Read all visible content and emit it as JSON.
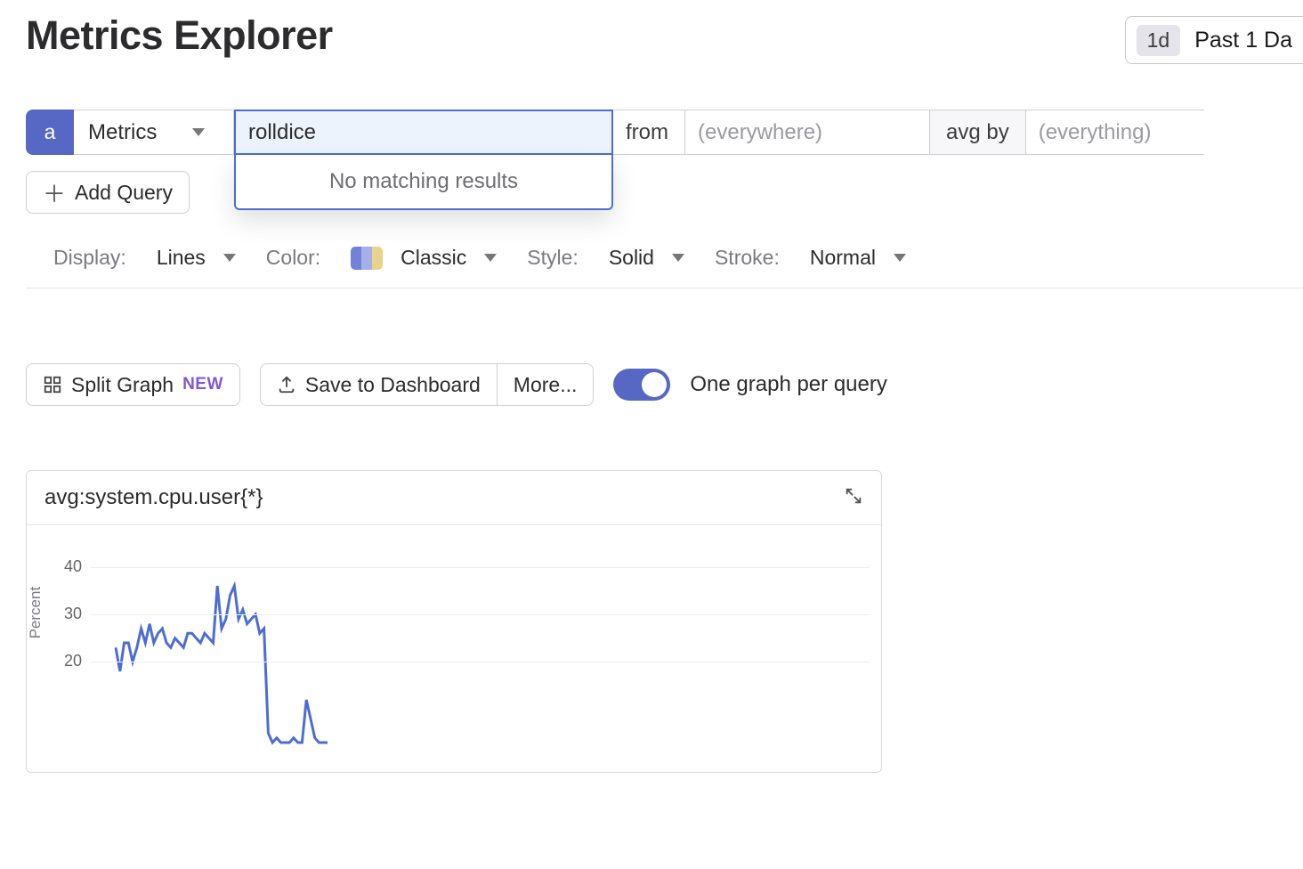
{
  "header": {
    "title": "Metrics Explorer",
    "time_pill": "1d",
    "time_label": "Past 1 Da"
  },
  "query": {
    "tag": "a",
    "source_label": "Metrics",
    "input_value": "rolldice",
    "dropdown_msg": "No matching results",
    "from_label": "from",
    "from_placeholder": "(everywhere)",
    "avg_by_label": "avg by",
    "group_placeholder": "(everything)",
    "add_query": "Add Query"
  },
  "display": {
    "display_label": "Display:",
    "display_value": "Lines",
    "color_label": "Color:",
    "color_value": "Classic",
    "style_label": "Style:",
    "style_value": "Solid",
    "stroke_label": "Stroke:",
    "stroke_value": "Normal"
  },
  "graph_controls": {
    "split_graph": "Split Graph",
    "new_badge": "NEW",
    "save": "Save to Dashboard",
    "more": "More...",
    "toggle_label": "One graph per query",
    "toggle_on": true
  },
  "chart": {
    "title": "avg:system.cpu.user{*}",
    "ylabel": "Percent"
  },
  "chart_data": {
    "type": "line",
    "title": "avg:system.cpu.user{*}",
    "xlabel": "",
    "ylabel": "Percent",
    "ylim": [
      0,
      45
    ],
    "y_ticks": [
      20,
      30,
      40
    ],
    "series": [
      {
        "name": "system.cpu.user",
        "color": "#4e6dd2",
        "values": [
          23,
          18,
          24,
          24,
          20,
          23,
          27,
          24,
          28,
          24,
          26,
          27,
          24,
          23,
          25,
          24,
          23,
          26,
          26,
          25,
          24,
          26,
          25,
          24,
          36,
          27,
          29,
          34,
          36,
          29,
          31,
          28,
          29,
          30,
          26,
          27,
          5,
          3,
          4,
          3,
          3,
          3,
          4,
          3,
          3,
          12,
          8,
          4,
          3,
          3,
          3
        ]
      }
    ]
  }
}
